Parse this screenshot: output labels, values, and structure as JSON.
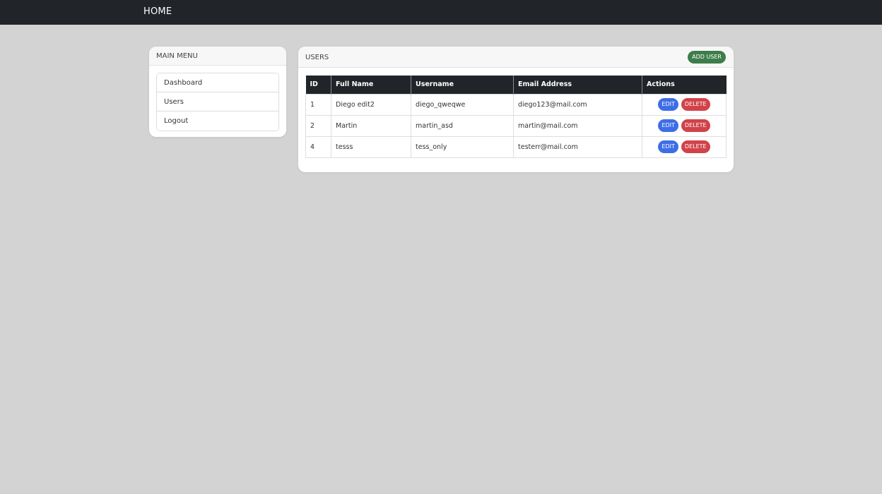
{
  "navbar": {
    "brand": "HOME"
  },
  "sidebar": {
    "title": "MAIN MENU",
    "items": [
      {
        "label": "Dashboard"
      },
      {
        "label": "Users"
      },
      {
        "label": "Logout"
      }
    ]
  },
  "users": {
    "title": "USERS",
    "add_label": "ADD USER",
    "columns": [
      "ID",
      "Full Name",
      "Username",
      "Email Address",
      "Actions"
    ],
    "edit_label": "EDIT",
    "delete_label": "DELETE",
    "rows": [
      {
        "id": "1",
        "full_name": "Diego edit2",
        "username": "diego_qweqwe",
        "email": "diego123@mail.com"
      },
      {
        "id": "2",
        "full_name": "Martin",
        "username": "martin_asd",
        "email": "martin@mail.com"
      },
      {
        "id": "4",
        "full_name": "tesss",
        "username": "tess_only",
        "email": "testerr@mail.com"
      }
    ]
  },
  "colors": {
    "navbar": "#212529",
    "background": "#d3d3d3",
    "add_button": "#3d7d4a",
    "edit_button": "#3d6ee6",
    "delete_button": "#d14349"
  }
}
